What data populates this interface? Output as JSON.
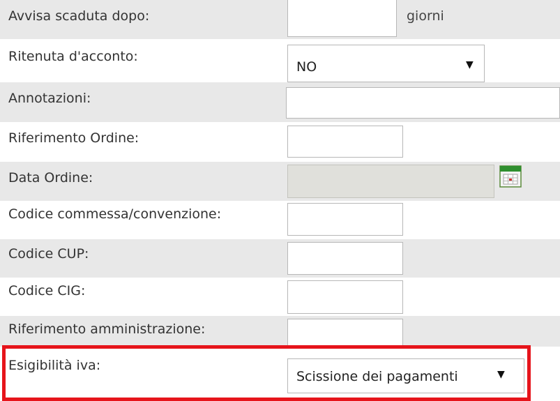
{
  "form": {
    "scadenza": {
      "label": "Avvisa scaduta dopo:",
      "value": "",
      "unit": "giorni"
    },
    "ritenuta": {
      "label": "Ritenuta d'acconto:",
      "selected": "NO"
    },
    "annotazioni": {
      "label": "Annotazioni:",
      "value": ""
    },
    "riferimento_ordine": {
      "label": "Riferimento Ordine:",
      "value": ""
    },
    "data_ordine": {
      "label": "Data Ordine:",
      "value": "",
      "icon": "calendar-icon"
    },
    "codice_commessa": {
      "label": "Codice commessa/convenzione:",
      "value": ""
    },
    "codice_cup": {
      "label": "Codice CUP:",
      "value": ""
    },
    "codice_cig": {
      "label": "Codice CIG:",
      "value": ""
    },
    "riferimento_amministrazione": {
      "label": "Riferimento amministrazione:",
      "value": ""
    },
    "esigibilita_iva": {
      "label": "Esigibilità iva:",
      "selected": "Scissione dei pagamenti"
    }
  },
  "colors": {
    "row_shade": "#e8e8e8",
    "highlight": "#e6141b",
    "disabled_input": "#e0e0db"
  }
}
